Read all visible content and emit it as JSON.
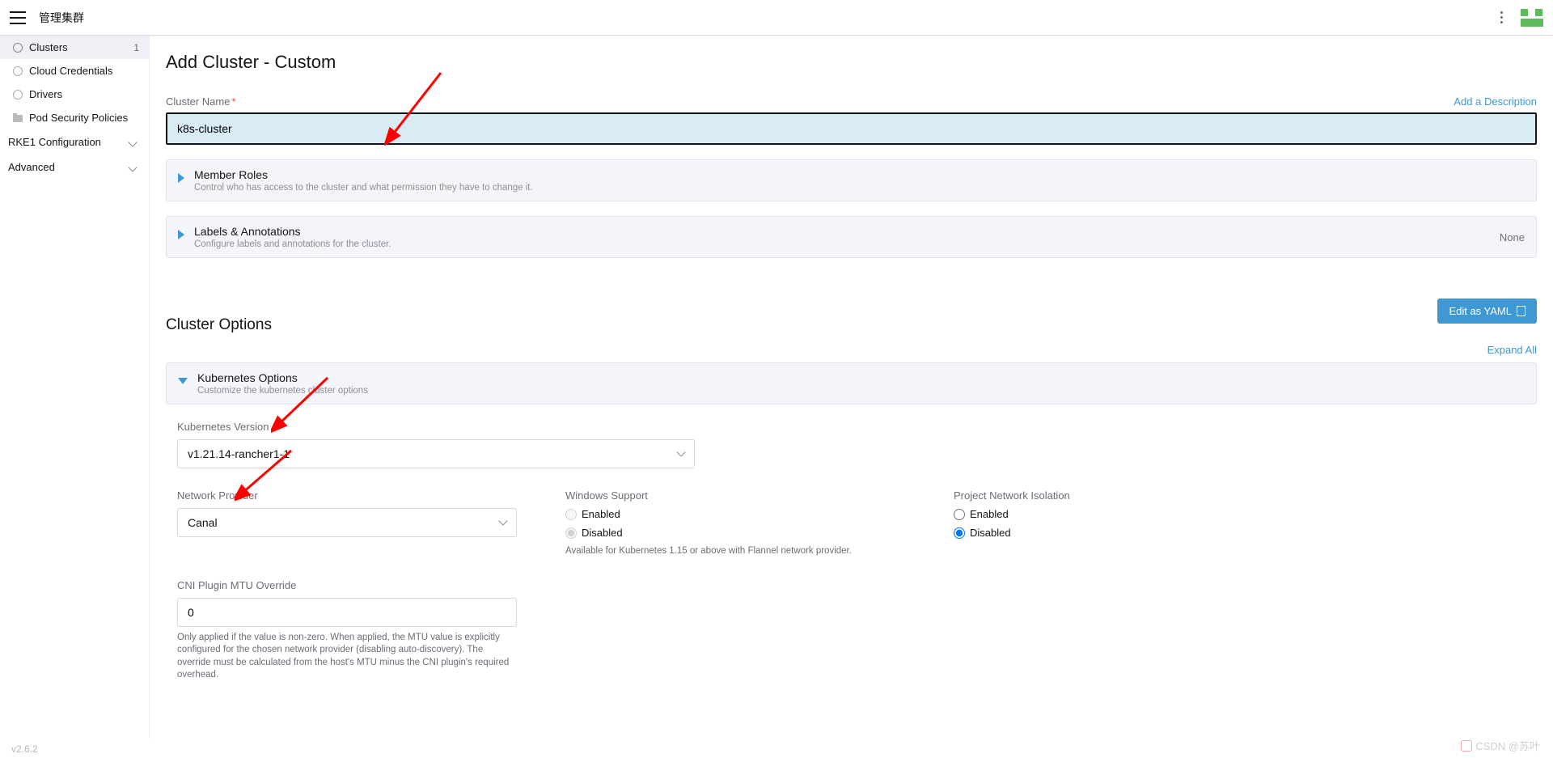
{
  "topbar": {
    "title": "管理集群"
  },
  "sidebar": {
    "items": [
      {
        "label": "Clusters",
        "badge": "1",
        "icon": "gear",
        "active": true
      },
      {
        "label": "Cloud Credentials",
        "icon": "circle"
      },
      {
        "label": "Drivers",
        "icon": "circle"
      },
      {
        "label": "Pod Security Policies",
        "icon": "folder"
      }
    ],
    "groups": [
      {
        "label": "RKE1 Configuration"
      },
      {
        "label": "Advanced"
      }
    ]
  },
  "page": {
    "title": "Add Cluster - Custom",
    "cluster_name_label": "Cluster Name",
    "cluster_name_value": "k8s-cluster",
    "add_description": "Add a Description",
    "member_roles": {
      "title": "Member Roles",
      "sub": "Control who has access to the cluster and what permission they have to change it."
    },
    "labels": {
      "title": "Labels & Annotations",
      "sub": "Configure labels and annotations for the cluster.",
      "tag": "None"
    },
    "cluster_options": "Cluster Options",
    "edit_yaml": "Edit as YAML",
    "expand_all": "Expand All",
    "k8s_options": {
      "title": "Kubernetes Options",
      "sub": "Customize the kubernetes cluster options"
    },
    "k8s_version_label": "Kubernetes Version",
    "k8s_version_value": "v1.21.14-rancher1-1",
    "network_provider_label": "Network Provider",
    "network_provider_value": "Canal",
    "windows_support_label": "Windows Support",
    "windows_support_help": "Available for Kubernetes 1.15 or above with Flannel network provider.",
    "project_isolation_label": "Project Network Isolation",
    "enabled": "Enabled",
    "disabled": "Disabled",
    "cni_mtu_label": "CNI Plugin MTU Override",
    "cni_mtu_value": "0",
    "cni_mtu_help": "Only applied if the value is non-zero. When applied, the MTU value is explicitly configured for the chosen network provider (disabling auto-discovery). The override must be calculated from the host's MTU minus the CNI plugin's required overhead."
  },
  "footer": {
    "version": "v2.6.2"
  },
  "watermark": "CSDN @苏叶"
}
